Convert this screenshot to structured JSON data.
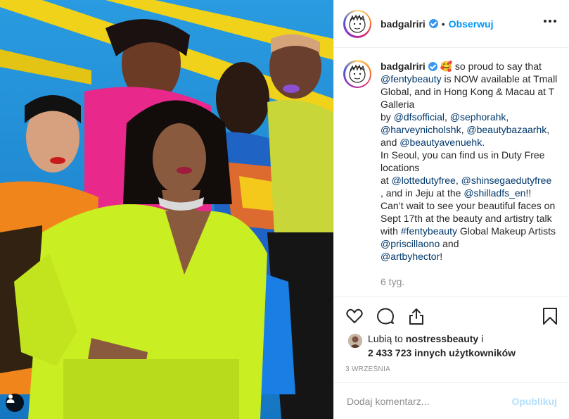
{
  "post": {
    "username": "badgalriri",
    "follow_label": "Obserwuj",
    "separator": "•",
    "caption": {
      "emoji": "🥰",
      "segments": [
        {
          "t": "so proud to say that ",
          "link": false
        },
        {
          "t": "@fentybeauty",
          "link": true
        },
        {
          "t": " is NOW available at Tmall Global, and in Hong Kong & Macau at T Galleria",
          "link": false
        },
        {
          "t": "\nby ",
          "link": false
        },
        {
          "t": "@dfsofficial",
          "link": true
        },
        {
          "t": ", ",
          "link": false
        },
        {
          "t": "@sephorahk",
          "link": true
        },
        {
          "t": ", ",
          "link": false
        },
        {
          "t": "@harveynicholshk",
          "link": true
        },
        {
          "t": ", ",
          "link": false
        },
        {
          "t": "@beautybazaarhk",
          "link": true
        },
        {
          "t": ",\nand ",
          "link": false
        },
        {
          "t": "@beautyavenuehk",
          "link": true
        },
        {
          "t": ".\nIn Seoul, you can find us in Duty Free locations\nat ",
          "link": false
        },
        {
          "t": "@lottedutyfree",
          "link": true
        },
        {
          "t": ", ",
          "link": false
        },
        {
          "t": "@shinsegaedutyfree",
          "link": true
        },
        {
          "t": "\n, and in Jeju at the ",
          "link": false
        },
        {
          "t": "@shilladfs_en",
          "link": true
        },
        {
          "t": "!!\nCan’t wait to see your beautiful faces on Sept 17th at the beauty and artistry talk with ",
          "link": false
        },
        {
          "t": "#fentybeauty",
          "link": true
        },
        {
          "t": " Global Makeup Artists ",
          "link": false
        },
        {
          "t": "@priscillaono",
          "link": true
        },
        {
          "t": " and\n",
          "link": false
        },
        {
          "t": "@artbyhector",
          "link": true
        },
        {
          "t": "!",
          "link": false
        }
      ]
    },
    "time_ago": "6 tyg.",
    "likes": {
      "prefix": "Lubią to ",
      "user": "nostressbeauty",
      "suffix": " i",
      "count_text": "2 433 723 innych użytkowników"
    },
    "date": "3 WRZEŚNIA",
    "comment": {
      "placeholder": "Dodaj komentarz...",
      "post_label": "Opublikuj"
    }
  },
  "icons": {
    "more": "more-options-icon",
    "like": "heart-icon",
    "comment": "comment-icon",
    "share": "share-icon",
    "save": "bookmark-icon",
    "tags": "user-tag-icon",
    "verified": "verified-badge-icon"
  },
  "colors": {
    "link": "#00376b",
    "follow": "#0095f6",
    "post_disabled": "#b2dffc",
    "muted": "#8e8e8e",
    "verified": "#3897f0"
  }
}
